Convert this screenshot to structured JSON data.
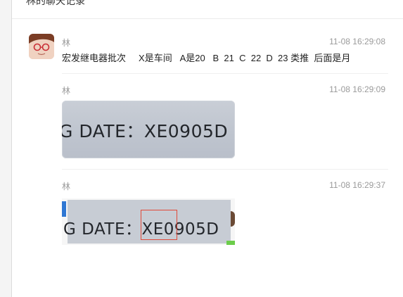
{
  "header": {
    "title": "林的聊天记录"
  },
  "messages": [
    {
      "sender": "林",
      "time": "11-08 16:29:08",
      "text": "宏发继电器批次     X是车间   A是20   B  21  C  22  D  23 类推  后面是月"
    },
    {
      "sender": "林",
      "time": "11-08 16:29:09",
      "image_text": "G DATE：XE0905D"
    },
    {
      "sender": "林",
      "time": "11-08 16:29:37",
      "image_text": "G DATE：XE0905D"
    }
  ],
  "colors": {
    "meta": "#9a9a9a",
    "highlight": "#e04a3a"
  }
}
